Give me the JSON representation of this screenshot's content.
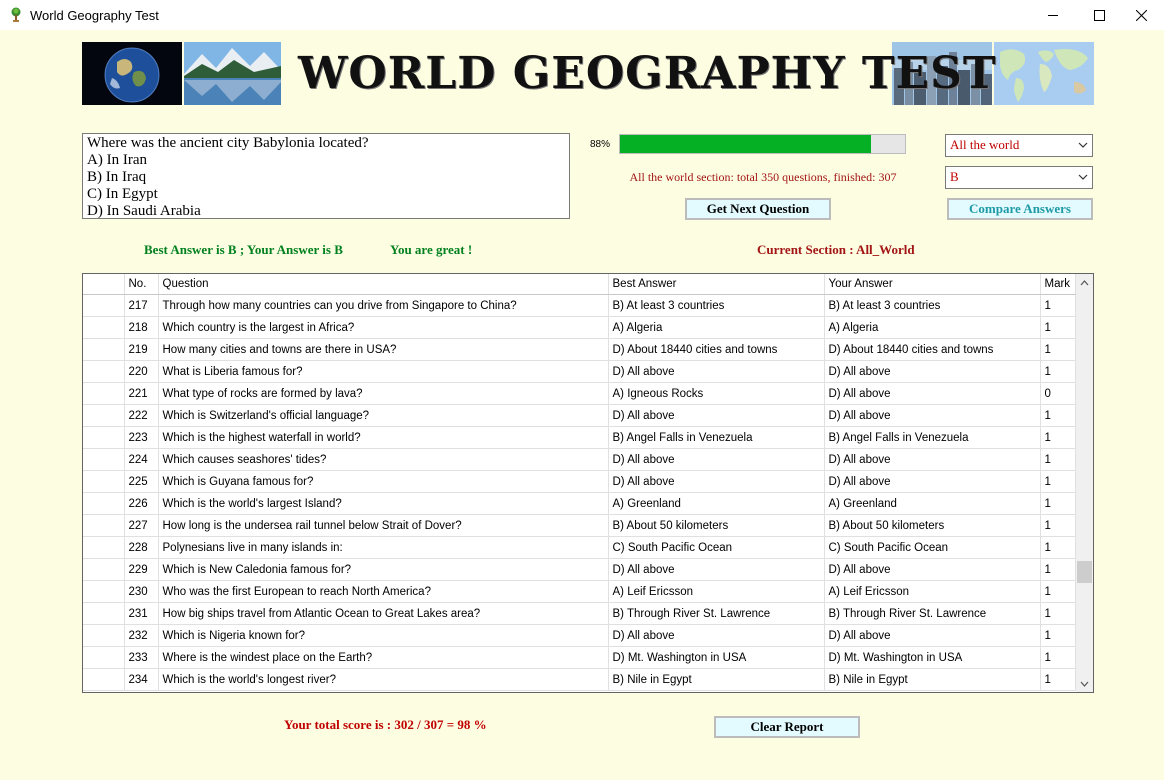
{
  "window": {
    "title": "World Geography Test",
    "controls": {
      "minimize_icon": "minimize-icon",
      "maximize_icon": "maximize-icon",
      "close_icon": "close-icon"
    }
  },
  "banner": {
    "title": "WORLD GEOGRAPHY TEST",
    "images": [
      "earth-globe-image",
      "mountain-lake-image",
      "city-skyline-image",
      "world-map-image"
    ]
  },
  "question": {
    "text": "Where was the ancient city Babylonia located?",
    "options": [
      "A) In Iran",
      "B) In Iraq",
      "C) In Egypt",
      "D) In Saudi Arabia"
    ]
  },
  "progress": {
    "label": "88%",
    "value": 0.88,
    "status": "All the world section: total 350 questions, finished: 307"
  },
  "controls": {
    "section_select": "All the world",
    "answer_select": "B",
    "next_button": "Get Next Question",
    "compare_button": "Compare  Answers",
    "clear_button": "Clear Report"
  },
  "result": {
    "best_answer": "Best Answer is B ;  Your Answer is B",
    "feedback": "You are great !",
    "current_section": "Current Section :  All_World"
  },
  "table": {
    "headers": [
      "No.",
      "Question",
      "Best Answer",
      "Your Answer",
      "Mark"
    ],
    "rows": [
      [
        "217",
        "Through how many countries can you drive from Singapore to China?",
        "B) At least 3 countries",
        "B) At least 3 countries",
        "1"
      ],
      [
        "218",
        "Which country is the largest in Africa?",
        "A) Algeria",
        "A) Algeria",
        "1"
      ],
      [
        "219",
        "How many cities and towns are there in USA?",
        "D) About 18440 cities and towns",
        "D) About 18440 cities and towns",
        "1"
      ],
      [
        "220",
        "What is Liberia famous for?",
        "D) All above",
        "D) All above",
        "1"
      ],
      [
        "221",
        "What type of rocks are formed by lava?",
        "A) Igneous Rocks",
        "D) All above",
        "0"
      ],
      [
        "222",
        "Which is Switzerland's official language?",
        "D) All above",
        "D) All above",
        "1"
      ],
      [
        "223",
        "Which is the highest waterfall in world?",
        "B) Angel Falls in Venezuela",
        "B) Angel Falls in Venezuela",
        "1"
      ],
      [
        "224",
        "Which causes seashores' tides?",
        "D) All above",
        "D) All above",
        "1"
      ],
      [
        "225",
        "Which is Guyana famous for?",
        "D) All above",
        "D) All above",
        "1"
      ],
      [
        "226",
        "Which is the world's largest Island?",
        "A) Greenland",
        "A) Greenland",
        "1"
      ],
      [
        "227",
        "How long is the undersea rail tunnel below Strait of Dover?",
        "B) About 50 kilometers",
        "B) About 50 kilometers",
        "1"
      ],
      [
        "228",
        "Polynesians live in many islands in:",
        "C) South Pacific Ocean",
        "C) South Pacific Ocean",
        "1"
      ],
      [
        "229",
        "Which is New Caledonia famous for?",
        "D) All above",
        "D) All above",
        "1"
      ],
      [
        "230",
        "Who was the first European to reach North America?",
        "A) Leif Ericsson",
        "A) Leif Ericsson",
        "1"
      ],
      [
        "231",
        "How big ships travel from Atlantic Ocean to Great Lakes area?",
        "B) Through River St. Lawrence",
        "B) Through River St. Lawrence",
        "1"
      ],
      [
        "232",
        "Which is Nigeria known for?",
        "D) All above",
        "D) All above",
        "1"
      ],
      [
        "233",
        "Where is the windest place on the Earth?",
        "D) Mt. Washington in USA",
        "D) Mt. Washington in USA",
        "1"
      ],
      [
        "234",
        "Which is the world's longest river?",
        "B) Nile in Egypt",
        "B) Nile in Egypt",
        "1"
      ]
    ]
  },
  "score": {
    "text": "Your total score is : 302 / 307  =  98 %"
  },
  "colors": {
    "background": "#fdfde2",
    "progress_fill": "#06b025",
    "green_text": "#00801e",
    "red_text": "#a31515",
    "score_red": "#c00000",
    "compare_teal": "#1e9aa6",
    "button_bg": "#e3fbff"
  }
}
